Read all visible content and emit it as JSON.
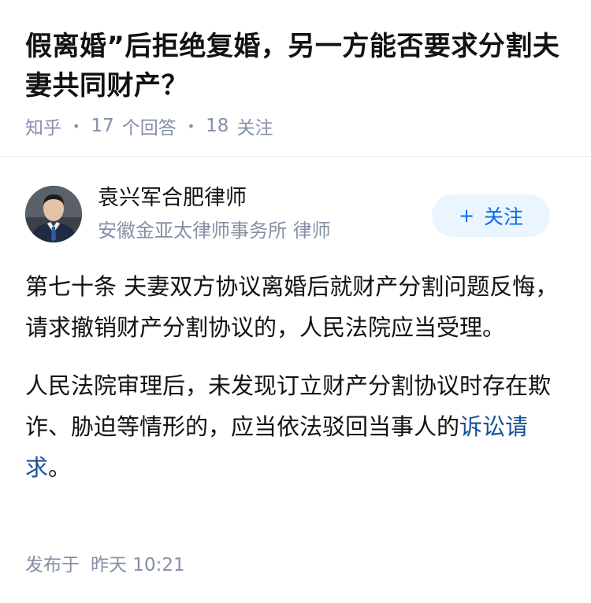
{
  "question": {
    "title": "假离婚”后拒绝复婚，另一方能否要求分割夫妻共同财产？",
    "source": "知乎",
    "answer_count": "17",
    "answer_unit": "个回答",
    "follow_count": "18",
    "follow_unit": "关注"
  },
  "author": {
    "name": "袁兴军合肥律师",
    "description": "安徽金亚太律师事务所 律师",
    "follow_label": "关注",
    "follow_plus": "+"
  },
  "answer": {
    "paragraph1": "第七十条 夫妻双方协议离婚后就财产分割问题反悔，请求撤销财产分割协议的，人民法院应当受理。",
    "paragraph2_text": "人民法院审理后，未发现订立财产分割协议时存在欺诈、胁迫等情形的，应当依法驳回当事人的",
    "paragraph2_link": "诉讼请求",
    "paragraph2_end": "。"
  },
  "published": {
    "label": "发布于",
    "time": "昨天 10:21"
  },
  "colors": {
    "meta": "#8590a6",
    "accent": "#056de8",
    "link": "#175199",
    "follow_bg": "#ebf5ff"
  }
}
